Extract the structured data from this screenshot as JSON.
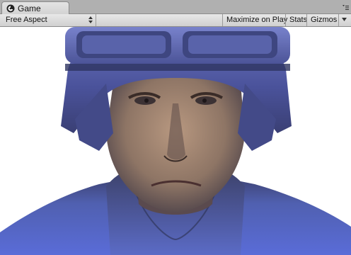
{
  "window": {
    "tab_title": "Game",
    "tab_icon": "unity-game-icon",
    "menu_icon": "window-menu-icon"
  },
  "toolbar": {
    "aspect_label": "Free Aspect",
    "maximize_label": "Maximize on Play",
    "stats_label": "Stats",
    "gizmos_label": "Gizmos"
  },
  "scene": {
    "subject": "soldier-head-render",
    "helmet_color": "#5a64b8",
    "body_color": "#4b5ac8",
    "background": "#ffffff"
  }
}
